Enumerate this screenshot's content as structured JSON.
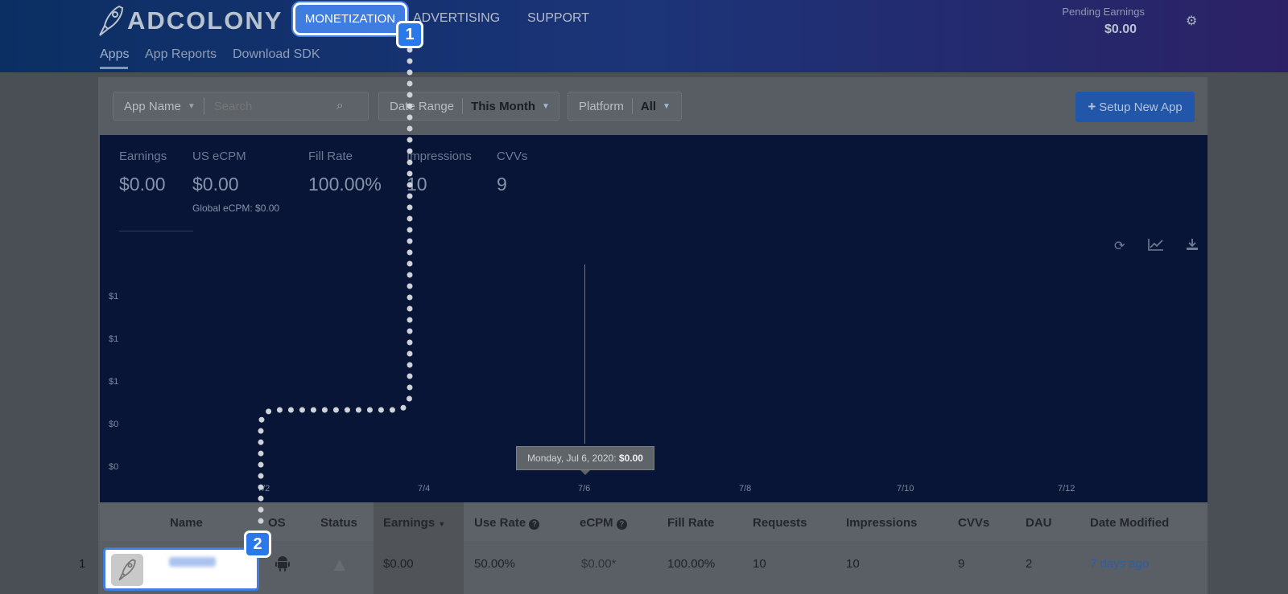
{
  "header": {
    "logo_text": "ADCOLONY",
    "nav": [
      "MONETIZATION",
      "ADVERTISING",
      "SUPPORT"
    ],
    "subnav": [
      "Apps",
      "App Reports",
      "Download SDK"
    ],
    "pending_label": "Pending Earnings",
    "pending_value": "$0.00"
  },
  "filters": {
    "app_name": "App Name",
    "search_placeholder": "Search",
    "date_range_label": "Date Range",
    "date_range_value": "This Month",
    "platform_label": "Platform",
    "platform_value": "All",
    "setup_button": "Setup New App"
  },
  "stats": [
    {
      "label": "Earnings",
      "value": "$0.00"
    },
    {
      "label": "US eCPM",
      "value": "$0.00"
    },
    {
      "label": "Fill Rate",
      "value": "100.00%"
    },
    {
      "label": "Impressions",
      "value": "10"
    },
    {
      "label": "CVVs",
      "value": "9"
    }
  ],
  "global_ecpm": "Global eCPM: $0.00",
  "chart_data": {
    "type": "line",
    "y_ticks": [
      "$1",
      "$1",
      "$1",
      "$0",
      "$0"
    ],
    "x_ticks": [
      "7/2",
      "7/4",
      "7/6",
      "7/8",
      "7/10",
      "7/12"
    ],
    "tooltip": {
      "label": "Monday, Jul 6, 2020:",
      "value": "$0.00"
    }
  },
  "table": {
    "columns": [
      "Name",
      "OS",
      "Status",
      "Earnings",
      "Use Rate",
      "eCPM",
      "Fill Rate",
      "Requests",
      "Impressions",
      "CVVs",
      "DAU",
      "Date Modified"
    ],
    "row": {
      "index": "1",
      "earnings": "$0.00",
      "use_rate": "50.00%",
      "ecpm": "$0.00*",
      "fill_rate": "100.00%",
      "requests": "10",
      "impressions": "10",
      "cvvs": "9",
      "dau": "2",
      "date_modified": "7 days ago"
    }
  },
  "badges": [
    "1",
    "2"
  ],
  "icons": {
    "gear": "gear-icon",
    "search": "search-icon",
    "plus": "plus-icon",
    "refresh": "refresh-icon",
    "chart": "line-chart-icon",
    "download": "download-icon",
    "android": "android-icon",
    "warning": "warning-icon",
    "help": "help-icon"
  }
}
